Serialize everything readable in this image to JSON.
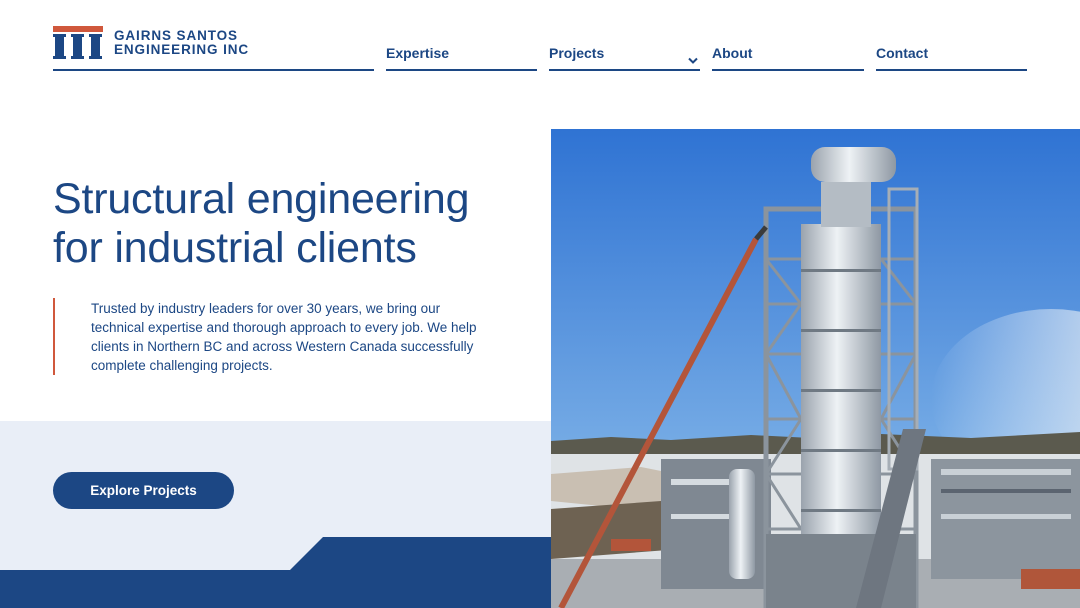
{
  "brand": {
    "name_line1": "GAIRNS SANTOS",
    "name_line2": "ENGINEERING INC",
    "logo_icon": "pillars-logo-icon"
  },
  "nav": {
    "items": [
      {
        "label": "Expertise"
      },
      {
        "label": "Projects",
        "icon": "chevron-down-icon"
      },
      {
        "label": "About"
      },
      {
        "label": "Contact"
      }
    ]
  },
  "hero": {
    "title_line1": "Structural engineering",
    "title_line2": "for industrial clients",
    "description": "Trusted by industry leaders for over 30 years, we bring our technical expertise and thorough approach to every job. We help clients in Northern BC and across Western Canada successfully complete challenging projects.",
    "cta_label": "Explore Projects"
  },
  "colors": {
    "primary_navy": "#1c4784",
    "accent_red": "#d0583c",
    "light_band": "#e9eef7",
    "white": "#ffffff"
  }
}
